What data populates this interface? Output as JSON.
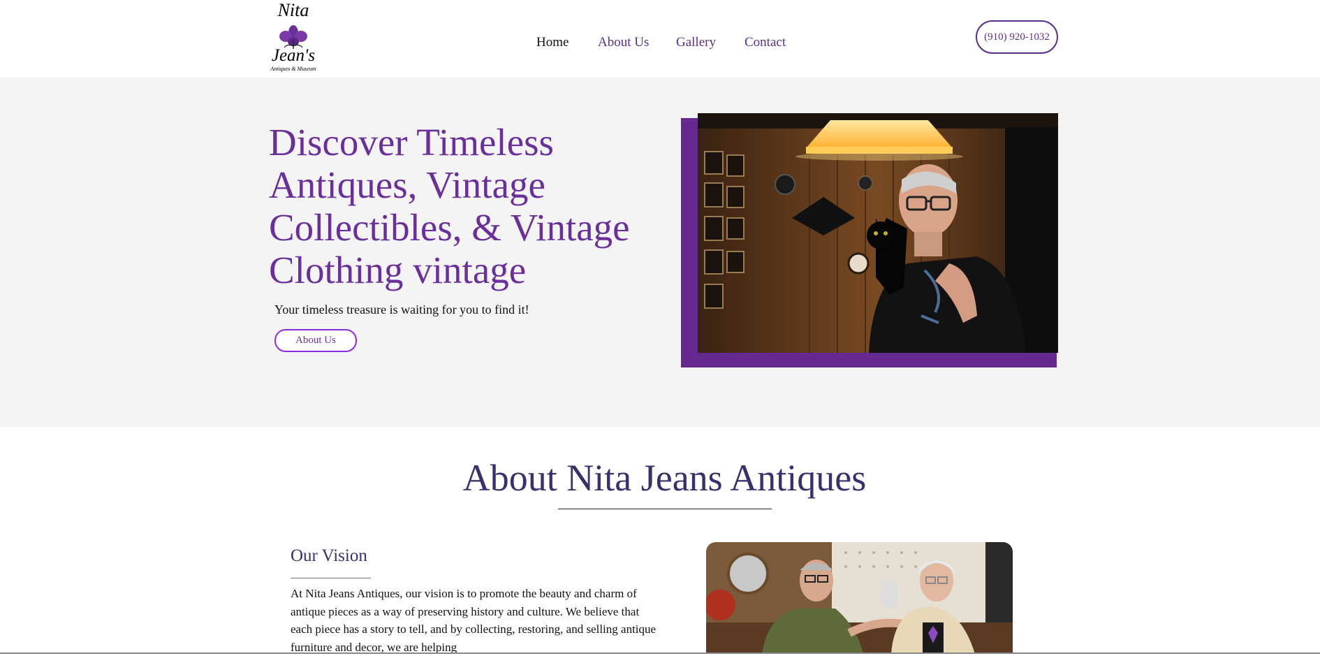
{
  "logo": {
    "line1": "Nita",
    "line2": "Jean's",
    "tagline": "Antiques & Museum",
    "color": "#6a2f9a"
  },
  "nav": {
    "items": [
      {
        "label": "Home",
        "active": true
      },
      {
        "label": "About Us",
        "active": false
      },
      {
        "label": "Gallery",
        "active": false
      },
      {
        "label": "Contact",
        "active": false
      }
    ]
  },
  "header": {
    "phone": "(910) 920-1032"
  },
  "hero": {
    "title": "Discover Timeless Antiques, Vintage Collectibles, & Vintage Clothing vintage",
    "subtitle": "Your timeless treasure is waiting for you to find it!",
    "button_label": "About Us"
  },
  "about": {
    "title": "About Nita Jeans Antiques",
    "vision_title": "Our Vision",
    "vision_text": "At Nita Jeans Antiques, our vision is to promote the beauty and charm of antique pieces as a way of preserving history and culture. We believe that each piece has a story to tell, and by collecting, restoring, and selling antique furniture and decor, we are helping"
  },
  "colors": {
    "accent": "#66298f",
    "heading": "#3c2f6e",
    "hero_bg": "#f4f4f4"
  }
}
